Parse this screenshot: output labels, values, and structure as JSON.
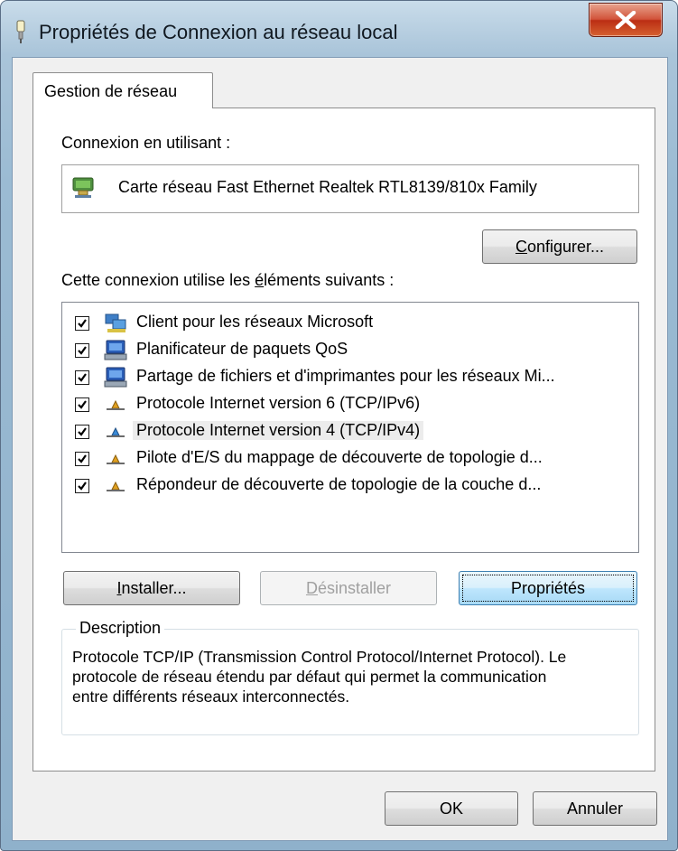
{
  "window": {
    "title": "Propriétés de Connexion au réseau local",
    "close_glyph": "X"
  },
  "tabs": [
    {
      "label": "Gestion de réseau",
      "active": true
    }
  ],
  "connect_using": {
    "label": "Connexion en utilisant :",
    "adapter": "Carte réseau Fast Ethernet Realtek RTL8139/810x Family",
    "icon": "network-adapter-icon"
  },
  "buttons": {
    "configure": {
      "before": "",
      "accel": "C",
      "after": "onfigurer..."
    },
    "install": {
      "before": "",
      "accel": "I",
      "after": "nstaller..."
    },
    "uninstall": {
      "before": "",
      "accel": "D",
      "after": "ésinstaller"
    },
    "properties": {
      "before": "Propriétés",
      "accel": "",
      "after": ""
    },
    "ok": "OK",
    "cancel": "Annuler"
  },
  "items_label": {
    "before": "Cette connexion utilise les ",
    "accel": "é",
    "after": "léments suivants :"
  },
  "items": [
    {
      "label": "Client pour les réseaux Microsoft",
      "checked": true,
      "icon": "network-client-icon"
    },
    {
      "label": "Planificateur de paquets QoS",
      "checked": true,
      "icon": "service-computer-icon"
    },
    {
      "label": "Partage de fichiers et d'imprimantes pour les réseaux Mi...",
      "checked": true,
      "icon": "service-computer-icon"
    },
    {
      "label": "Protocole Internet version 6 (TCP/IPv6)",
      "checked": true,
      "icon": "protocol-icon"
    },
    {
      "label": "Protocole Internet version 4 (TCP/IPv4)",
      "checked": true,
      "icon": "protocol-icon",
      "selected": true
    },
    {
      "label": "Pilote d'E/S du mappage de découverte de topologie d...",
      "checked": true,
      "icon": "protocol-icon"
    },
    {
      "label": "Répondeur de découverte de topologie de la couche d...",
      "checked": true,
      "icon": "protocol-icon"
    }
  ],
  "description": {
    "title": "Description",
    "text": "Protocole TCP/IP (Transmission Control Protocol/Internet Protocol). Le protocole de réseau étendu par défaut qui permet la communication entre différents réseaux interconnectés."
  },
  "colors": {
    "frame": "#9bbbd3",
    "close_button": "#c4371e",
    "default_button_border": "#3c7fb1"
  }
}
